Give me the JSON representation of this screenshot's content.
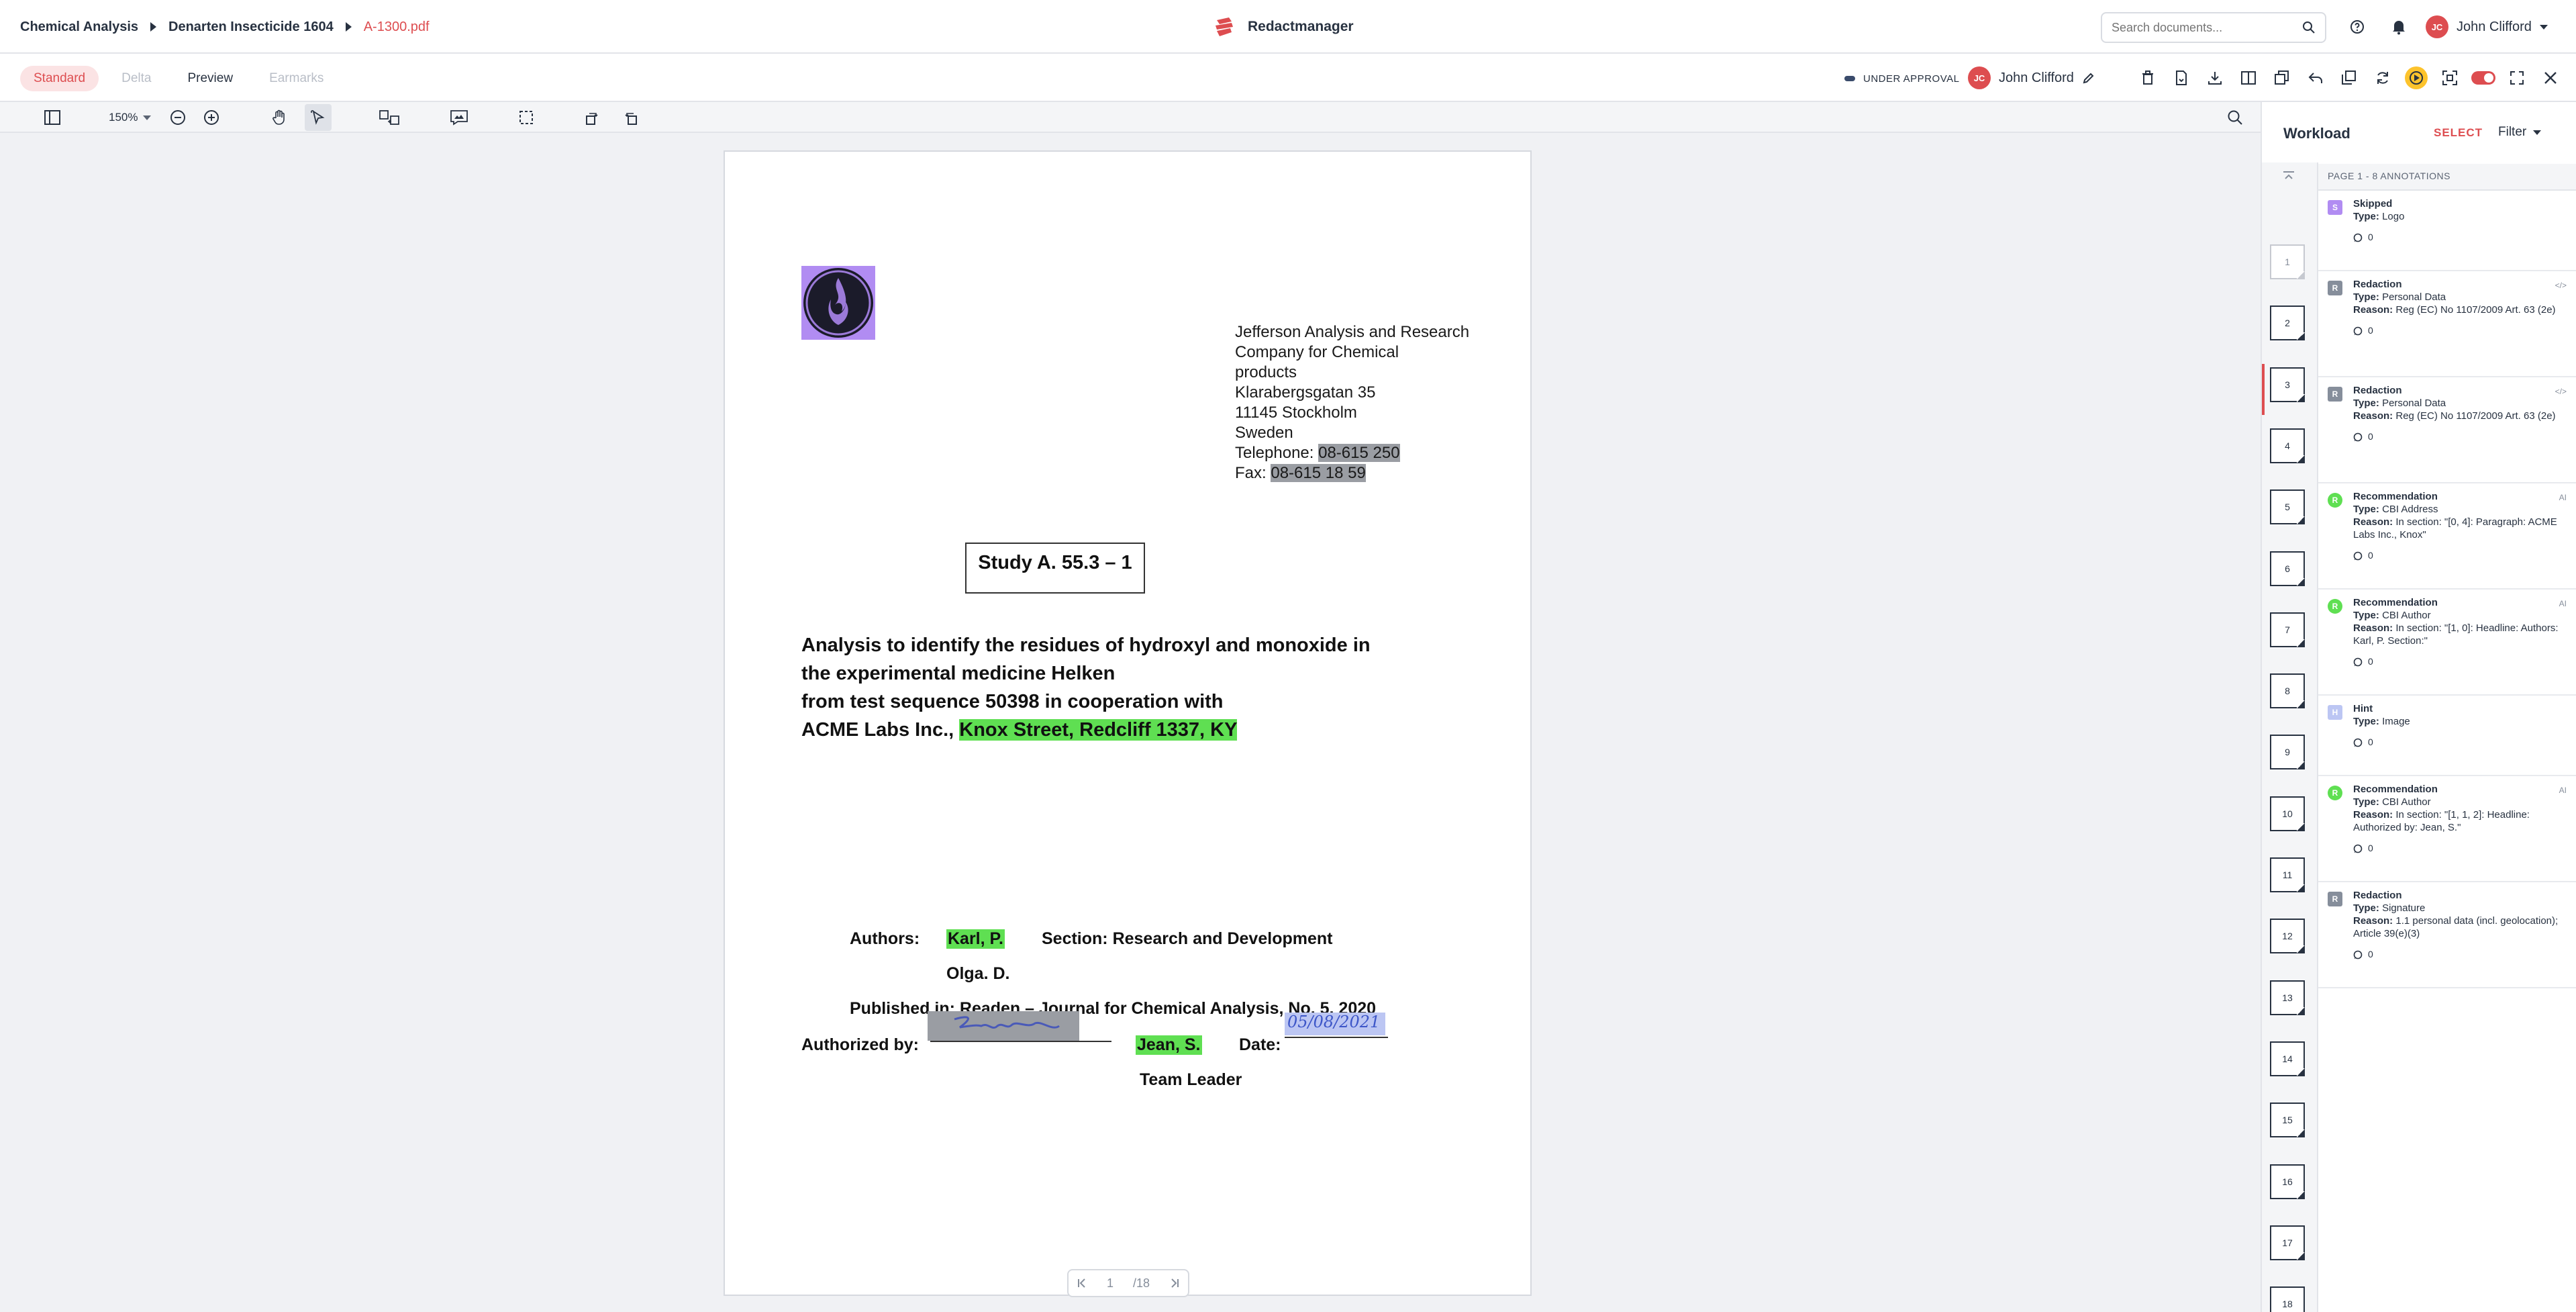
{
  "breadcrumb": [
    "Chemical Analysis",
    "Denarten Insecticide 1604",
    "A-1300.pdf"
  ],
  "app": {
    "name": "Redactmanager",
    "brand_color": "#dd4d50"
  },
  "search": {
    "placeholder": "Search documents..."
  },
  "user": {
    "initials": "JC",
    "name": "John Clifford"
  },
  "modes": {
    "standard": "Standard",
    "delta": "Delta",
    "preview": "Preview",
    "earmarks": "Earmarks"
  },
  "status": {
    "label": "UNDER APPROVAL",
    "assignee_initials": "JC",
    "assignee_name": "John Clifford"
  },
  "zoom": {
    "level": "150%"
  },
  "document": {
    "address": [
      "Jefferson Analysis and Research",
      "Company for Chemical",
      "products",
      "Klarabergsgatan 35",
      "11145 Stockholm",
      "Sweden"
    ],
    "telephone_label": "Telephone:",
    "telephone": "08-615 250",
    "fax_label": "Fax:",
    "fax": "08-615 18 59",
    "study": "Study A. 55.3 – 1",
    "title_lines": [
      "Analysis to identify the residues of hydroxyl and monoxide in",
      "the experimental medicine Helken",
      "from test sequence 50398 in cooperation with"
    ],
    "title_company": "ACME Labs Inc.,",
    "title_address": "Knox Street, Redcliff 1337, KY",
    "authors_label": "Authors:",
    "author1": "Karl, P.",
    "section": "Section: Research and Development",
    "author2": "Olga. D.",
    "published": "Published in: Readen – Journal for Chemical Analysis, No. 5, 2020",
    "authorized_label": "Authorized by:",
    "authorized_name": "Jean, S.",
    "date_label": "Date:",
    "date_value": "05/08/2021",
    "role": "Team Leader"
  },
  "pager": {
    "current": "1",
    "total": "/18"
  },
  "panel": {
    "title": "Workload",
    "select": "SELECT",
    "filter": "Filter",
    "list_header": "PAGE 1 - 8 ANNOTATIONS",
    "pages": [
      "1",
      "2",
      "3",
      "4",
      "5",
      "6",
      "7",
      "8",
      "9",
      "10",
      "11",
      "12",
      "13",
      "14",
      "15",
      "16",
      "17",
      "18"
    ],
    "annotations": [
      {
        "kind": "Skipped",
        "type_label": "Type:",
        "type": "Logo",
        "reason_label": "",
        "reason": "",
        "comments": "0",
        "badge": "S",
        "color": "#b18cf2",
        "flag": ""
      },
      {
        "kind": "Redaction",
        "type_label": "Type:",
        "type": "Personal Data",
        "reason_label": "Reason:",
        "reason": "Reg (EC) No 1107/2009 Art. 63 (2e)",
        "comments": "0",
        "badge": "R",
        "color": "#868e9b",
        "flag": "</>"
      },
      {
        "kind": "Redaction",
        "type_label": "Type:",
        "type": "Personal Data",
        "reason_label": "Reason:",
        "reason": "Reg (EC) No 1107/2009 Art. 63 (2e)",
        "comments": "0",
        "badge": "R",
        "color": "#868e9b",
        "flag": "</>"
      },
      {
        "kind": "Recommendation",
        "type_label": "Type:",
        "type": "CBI Address",
        "reason_label": "Reason:",
        "reason": "In section: \"[0, 4]: Paragraph: ACME Labs Inc., Knox\"",
        "comments": "0",
        "badge": "R",
        "color": "#5fdf52",
        "flag": "AI"
      },
      {
        "kind": "Recommendation",
        "type_label": "Type:",
        "type": "CBI Author",
        "reason_label": "Reason:",
        "reason": "In section: \"[1, 0]: Headline: Authors: Karl, P. Section:\"",
        "comments": "0",
        "badge": "R",
        "color": "#5fdf52",
        "flag": "AI"
      },
      {
        "kind": "Hint",
        "type_label": "Type:",
        "type": "Image",
        "reason_label": "",
        "reason": "",
        "comments": "0",
        "badge": "H",
        "color": "#bcc6f3",
        "flag": ""
      },
      {
        "kind": "Recommendation",
        "type_label": "Type:",
        "type": "CBI Author",
        "reason_label": "Reason:",
        "reason": "In section: \"[1, 1, 2]: Headline: Authorized by: Jean, S.\"",
        "comments": "0",
        "badge": "R",
        "color": "#5fdf52",
        "flag": "AI"
      },
      {
        "kind": "Redaction",
        "type_label": "Type:",
        "type": "Signature",
        "reason_label": "Reason:",
        "reason": "1.1 personal data (incl. geolocation); Article 39(e)(3)",
        "comments": "0",
        "badge": "R",
        "color": "#868e9b",
        "flag": ""
      }
    ]
  }
}
